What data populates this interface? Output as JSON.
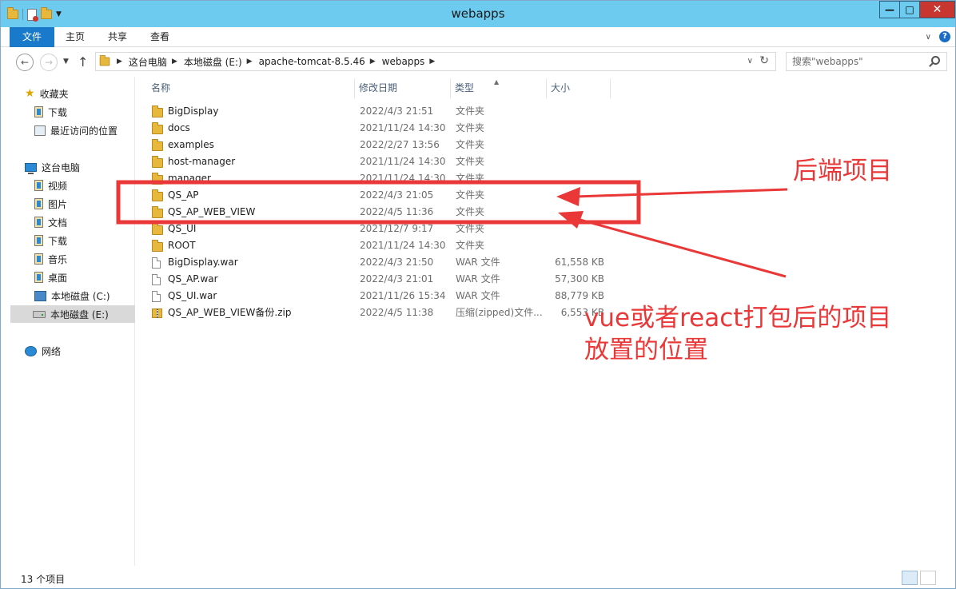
{
  "window": {
    "title": "webapps",
    "controls": {
      "minimize": "—",
      "maximize": "□",
      "close": "✕"
    }
  },
  "ribbon": {
    "tabs": [
      "文件",
      "主页",
      "共享",
      "查看"
    ]
  },
  "address": {
    "crumbs": [
      "这台电脑",
      "本地磁盘 (E:)",
      "apache-tomcat-8.5.46",
      "webapps"
    ],
    "search_placeholder": "搜索\"webapps\""
  },
  "navpane": {
    "favorites": {
      "label": "收藏夹",
      "items": [
        "下载",
        "最近访问的位置"
      ]
    },
    "thispc": {
      "label": "这台电脑",
      "items": [
        "视频",
        "图片",
        "文档",
        "下载",
        "音乐",
        "桌面",
        "本地磁盘 (C:)",
        "本地磁盘 (E:)"
      ]
    },
    "network": "网络"
  },
  "filelist": {
    "columns": {
      "name": "名称",
      "date": "修改日期",
      "type": "类型",
      "size": "大小"
    },
    "rows": [
      {
        "name": "BigDisplay",
        "date": "2022/4/3 21:51",
        "type": "文件夹",
        "size": "",
        "icon": "folder-icon"
      },
      {
        "name": "docs",
        "date": "2021/11/24 14:30",
        "type": "文件夹",
        "size": "",
        "icon": "folder-icon"
      },
      {
        "name": "examples",
        "date": "2022/2/27 13:56",
        "type": "文件夹",
        "size": "",
        "icon": "folder-icon"
      },
      {
        "name": "host-manager",
        "date": "2021/11/24 14:30",
        "type": "文件夹",
        "size": "",
        "icon": "folder-icon"
      },
      {
        "name": "manager",
        "date": "2021/11/24 14:30",
        "type": "文件夹",
        "size": "",
        "icon": "folder-icon"
      },
      {
        "name": "QS_AP",
        "date": "2022/4/3 21:05",
        "type": "文件夹",
        "size": "",
        "icon": "folder-icon"
      },
      {
        "name": "QS_AP_WEB_VIEW",
        "date": "2022/4/5 11:36",
        "type": "文件夹",
        "size": "",
        "icon": "folder-icon"
      },
      {
        "name": "QS_UI",
        "date": "2021/12/7 9:17",
        "type": "文件夹",
        "size": "",
        "icon": "folder-icon"
      },
      {
        "name": "ROOT",
        "date": "2021/11/24 14:30",
        "type": "文件夹",
        "size": "",
        "icon": "folder-icon"
      },
      {
        "name": "BigDisplay.war",
        "date": "2022/4/3 21:50",
        "type": "WAR 文件",
        "size": "61,558 KB",
        "icon": "file-icon"
      },
      {
        "name": "QS_AP.war",
        "date": "2022/4/3 21:01",
        "type": "WAR 文件",
        "size": "57,300 KB",
        "icon": "file-icon"
      },
      {
        "name": "QS_UI.war",
        "date": "2021/11/26 15:34",
        "type": "WAR 文件",
        "size": "88,779 KB",
        "icon": "file-icon"
      },
      {
        "name": "QS_AP_WEB_VIEW备份.zip",
        "date": "2022/4/5 11:38",
        "type": "压缩(zipped)文件...",
        "size": "6,553 KB",
        "icon": "zip-icon"
      }
    ]
  },
  "status": {
    "count": "13 个项目"
  },
  "annotations": {
    "backend": "后端项目",
    "frontend_line1": "vue或者react打包后的项目",
    "frontend_line2": "放置的位置",
    "color": "#ea3838"
  }
}
